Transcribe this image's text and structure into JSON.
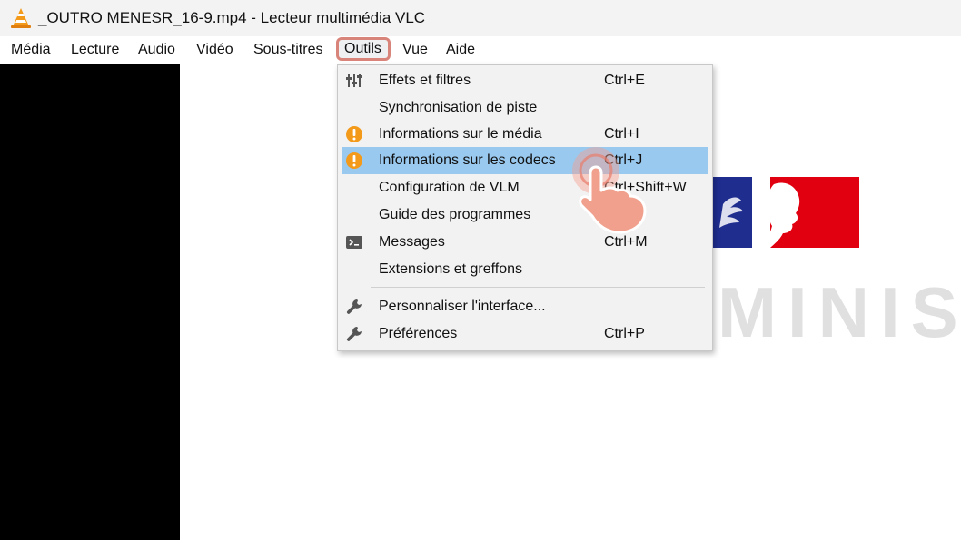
{
  "window": {
    "title": "_OUTRO MENESR_16-9.mp4 - Lecteur multimédia VLC"
  },
  "menubar": [
    {
      "label": "Média"
    },
    {
      "label": "Lecture"
    },
    {
      "label": "Audio"
    },
    {
      "label": "Vidéo"
    },
    {
      "label": "Sous-titres"
    },
    {
      "label": "Outils",
      "active": true
    },
    {
      "label": "Vue"
    },
    {
      "label": "Aide"
    }
  ],
  "menu_outils": {
    "items": [
      {
        "label": "Effets et filtres",
        "shortcut": "Ctrl+E",
        "icon": "equalizer-icon"
      },
      {
        "label": "Synchronisation de piste",
        "shortcut": "",
        "icon": ""
      },
      {
        "label": "Informations sur le média",
        "shortcut": "Ctrl+I",
        "icon": "info-icon"
      },
      {
        "label": "Informations sur les codecs",
        "shortcut": "Ctrl+J",
        "icon": "info-icon",
        "highlighted": true
      },
      {
        "label": "Configuration de VLM",
        "shortcut": "Ctrl+Shift+W",
        "icon": ""
      },
      {
        "label": "Guide des programmes",
        "shortcut": "",
        "icon": ""
      },
      {
        "label": "Messages",
        "shortcut": "Ctrl+M",
        "icon": "terminal-icon"
      },
      {
        "label": "Extensions et greffons",
        "shortcut": "",
        "icon": ""
      },
      {
        "label": "Personnaliser l'interface...",
        "shortcut": "",
        "icon": "wrench-icon"
      },
      {
        "label": "Préférences",
        "shortcut": "Ctrl+P",
        "icon": "wrench-icon"
      }
    ]
  },
  "video": {
    "watermark_text": "MINIST"
  },
  "colors": {
    "highlight": "#99c9ef",
    "active_outline": "#d9847a",
    "flag_blue": "#1f2d8f",
    "flag_red": "#e1000f"
  }
}
